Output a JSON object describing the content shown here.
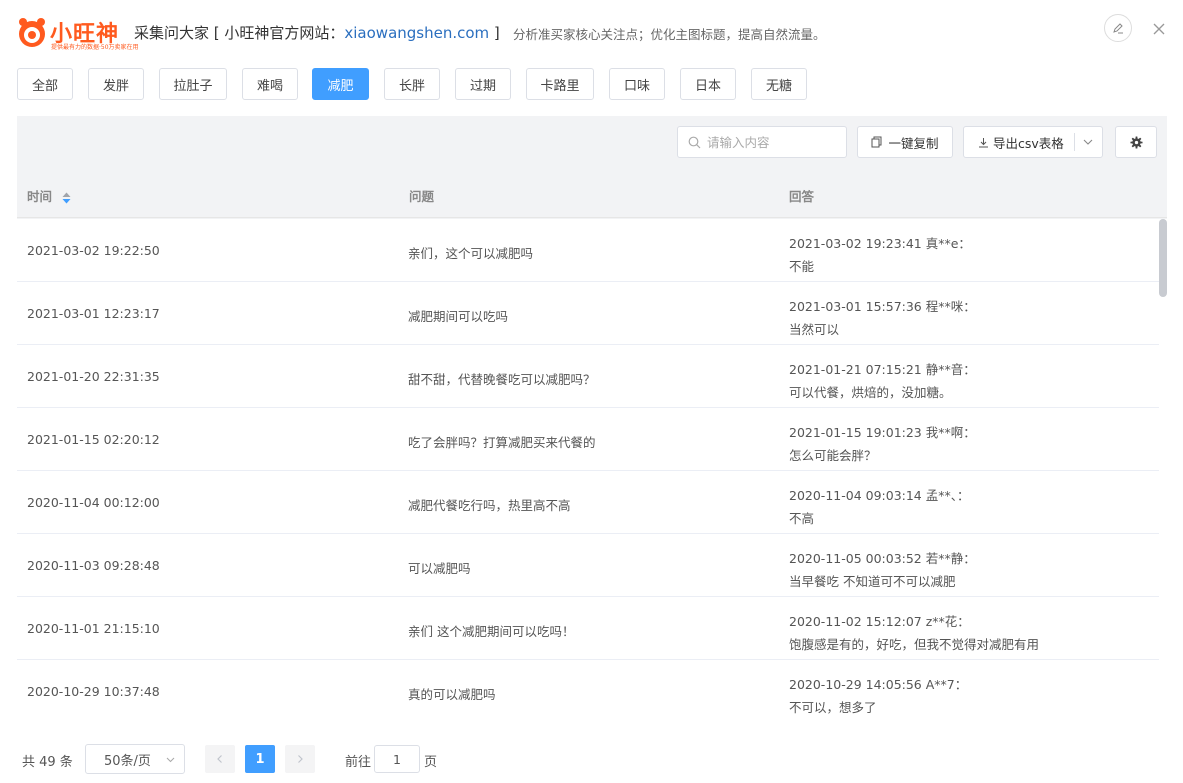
{
  "header": {
    "logo_text": "小旺神",
    "logo_sub": "提供最有力的数据·50万卖家在用",
    "title_prefix": "采集问大家 [ 小旺神官方网站：",
    "title_link": "xiaowangshen.com",
    "title_suffix": " ]",
    "subtitle": "分析准买家核心关注点；优化主图标题，提高自然流量。",
    "brand_color": "#ff5a1f",
    "icons": {
      "edit": "edit-icon",
      "close": "close-icon"
    }
  },
  "tabs": [
    {
      "label": "全部"
    },
    {
      "label": "发胖"
    },
    {
      "label": "拉肚子"
    },
    {
      "label": "难喝"
    },
    {
      "label": "减肥",
      "active": true
    },
    {
      "label": "长胖"
    },
    {
      "label": "过期"
    },
    {
      "label": "卡路里"
    },
    {
      "label": "口味"
    },
    {
      "label": "日本"
    },
    {
      "label": "无糖"
    }
  ],
  "toolbar": {
    "search_placeholder": "请输入内容",
    "copy_label": "一键复制",
    "export_label": "导出csv表格",
    "accent_color": "#409eff"
  },
  "table": {
    "columns": {
      "time": "时间",
      "question": "问题",
      "answer": "回答"
    },
    "rows": [
      {
        "time": "2021-03-02 19:22:50",
        "question": "亲们，这个可以减肥吗",
        "answer_meta": "2021-03-02 19:23:41  真**e：",
        "answer_text": "不能"
      },
      {
        "time": "2021-03-01 12:23:17",
        "question": "减肥期间可以吃吗",
        "answer_meta": "2021-03-01 15:57:36  程**咪：",
        "answer_text": "当然可以"
      },
      {
        "time": "2021-01-20 22:31:35",
        "question": "甜不甜，代替晚餐吃可以减肥吗？",
        "answer_meta": "2021-01-21 07:15:21  静**音：",
        "answer_text": "可以代餐，烘焙的，没加糖。"
      },
      {
        "time": "2021-01-15 02:20:12",
        "question": "吃了会胖吗？打算减肥买来代餐的",
        "answer_meta": "2021-01-15 19:01:23  我**啊：",
        "answer_text": "怎么可能会胖？"
      },
      {
        "time": "2020-11-04 00:12:00",
        "question": "减肥代餐吃行吗，热里高不高",
        "answer_meta": "2020-11-04 09:03:14  孟**、：",
        "answer_text": "不高"
      },
      {
        "time": "2020-11-03 09:28:48",
        "question": "可以减肥吗",
        "answer_meta": "2020-11-05 00:03:52  若**静：",
        "answer_text": "当早餐吃 不知道可不可以减肥"
      },
      {
        "time": "2020-11-01 21:15:10",
        "question": "亲们 这个减肥期间可以吃吗！",
        "answer_meta": "2020-11-02 15:12:07  z**花：",
        "answer_text": "饱腹感是有的，好吃，但我不觉得对减肥有用"
      },
      {
        "time": "2020-10-29 10:37:48",
        "question": "真的可以减肥吗",
        "answer_meta": "2020-10-29 14:05:56  A**7：",
        "answer_text": "不可以，想多了"
      }
    ]
  },
  "pagination": {
    "total": "共 49 条",
    "page_size": "50条/页",
    "current_page": "1",
    "goto_label": "前往",
    "goto_value": "1",
    "page_unit": "页"
  }
}
